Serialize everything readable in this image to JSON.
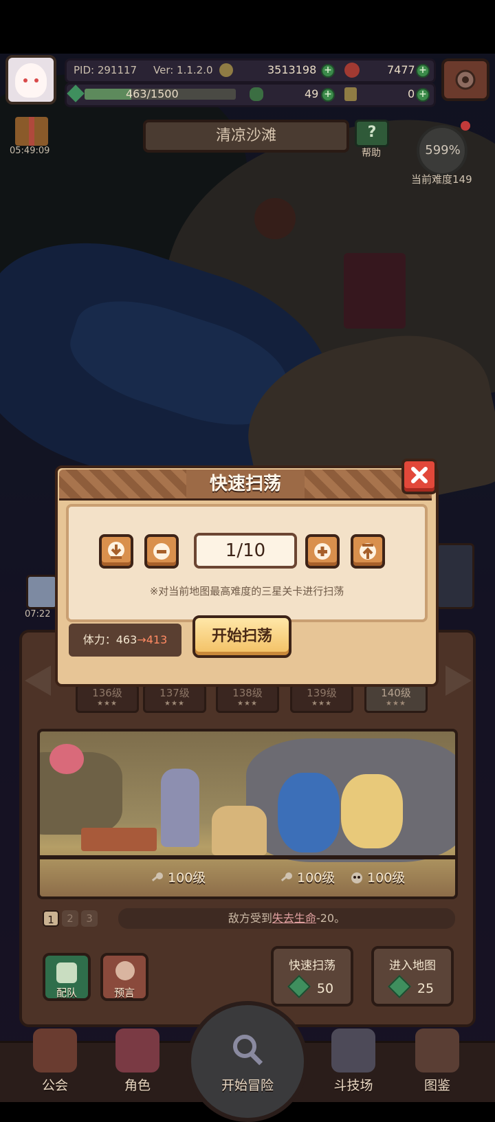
{
  "hud": {
    "pid": "PID: 291117",
    "version": "Ver: 1.1.2.0",
    "gold": "3513198",
    "gems": "7477",
    "stamina": "463/1500",
    "stamina_fill": 0.31,
    "clover": "49",
    "puzzle": "0",
    "gift_timer": "05:49:09",
    "stage_name": "清凉沙滩",
    "help_label": "帮助",
    "difficulty_percent": "599%",
    "difficulty_label": "当前难度149",
    "left_timer": "07:22"
  },
  "popup": {
    "title": "快速扫荡",
    "count": "1/10",
    "note": "※对当前地图最高难度的三星关卡进行扫荡",
    "stamina_label": "体力：463",
    "stamina_arrow": "→",
    "stamina_after": "413",
    "start_button": "开始扫荡"
  },
  "levels": {
    "chips": [
      {
        "label": "136级",
        "stars": "★★★"
      },
      {
        "label": "137级",
        "stars": "★★★"
      },
      {
        "label": "138级",
        "stars": "★★★"
      },
      {
        "label": "139级",
        "stars": "★★★"
      },
      {
        "label": "140级",
        "stars": "★★★"
      }
    ]
  },
  "battle": {
    "left_level": "100级",
    "right_level_1": "100级",
    "right_level_2": "100级"
  },
  "skill": {
    "tabs": [
      "1",
      "2",
      "3"
    ],
    "text_prefix": "敌方受到",
    "text_link": "失去生命",
    "text_suffix": "-20。"
  },
  "side_buttons": {
    "team": "配队",
    "preview": "预言"
  },
  "actions": {
    "sweep_label": "快速扫荡",
    "sweep_cost": "50",
    "enter_label": "进入地图",
    "enter_cost": "25"
  },
  "nav": {
    "guild": "公会",
    "role": "角色",
    "adventure": "开始冒险",
    "arena": "斗技场",
    "codex": "图鉴"
  },
  "colors": {
    "popup_bg": "#e7c596",
    "frame_dark": "#3d2317",
    "accent_red": "#e2483a",
    "gem_green": "#3f8f5e"
  }
}
